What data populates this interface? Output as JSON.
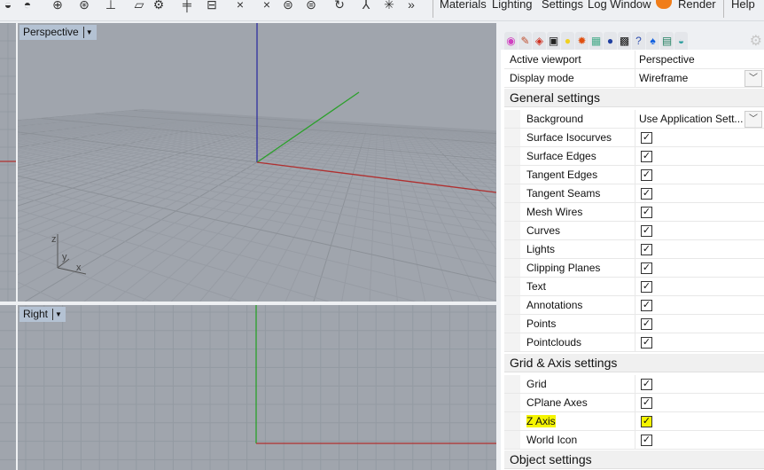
{
  "toolbar": {
    "menus": [
      "Materials",
      "Lighting",
      "Settings",
      "Log Window",
      "Render",
      "Help"
    ]
  },
  "viewports": {
    "top": {
      "label": "Perspective",
      "axis_labels": {
        "z": "z",
        "y": "y",
        "x": "x"
      }
    },
    "bottom": {
      "label": "Right"
    }
  },
  "panel": {
    "tabs": [
      "color-wheel",
      "pen",
      "layers",
      "display",
      "light",
      "sun",
      "keyboard",
      "bomb",
      "checker",
      "help-window",
      "bell",
      "image",
      "cloud"
    ],
    "active_viewport": {
      "label": "Active viewport",
      "value": "Perspective"
    },
    "display_mode": {
      "label": "Display mode",
      "value": "Wireframe"
    },
    "general": {
      "title": "General settings",
      "background": {
        "label": "Background",
        "value": "Use Application Sett..."
      },
      "items": [
        {
          "label": "Surface Isocurves",
          "checked": true
        },
        {
          "label": "Surface Edges",
          "checked": true
        },
        {
          "label": "Tangent Edges",
          "checked": true
        },
        {
          "label": "Tangent Seams",
          "checked": true
        },
        {
          "label": "Mesh Wires",
          "checked": true
        },
        {
          "label": "Curves",
          "checked": true
        },
        {
          "label": "Lights",
          "checked": true
        },
        {
          "label": "Clipping Planes",
          "checked": true
        },
        {
          "label": "Text",
          "checked": true
        },
        {
          "label": "Annotations",
          "checked": true
        },
        {
          "label": "Points",
          "checked": true
        },
        {
          "label": "Pointclouds",
          "checked": true
        }
      ]
    },
    "grid": {
      "title": "Grid & Axis settings",
      "items": [
        {
          "label": "Grid",
          "checked": true
        },
        {
          "label": "CPlane Axes",
          "checked": true
        },
        {
          "label": "Z Axis",
          "checked": true,
          "highlighted": true
        },
        {
          "label": "World Icon",
          "checked": true
        }
      ]
    },
    "object": {
      "title": "Object settings"
    }
  }
}
